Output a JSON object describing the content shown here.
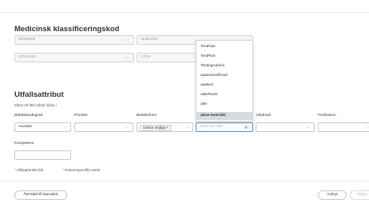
{
  "classification": {
    "title": "Medicinsk klassificeringskod",
    "row1_left_value": "SNOMED",
    "row1_right_value": "11381005",
    "row2_left_value": "ICD10-SE",
    "row2_right_value": "L70.9"
  },
  "attributes": {
    "title": "Utfallsattribut",
    "required_note": "Minst ett fält måste fyllas i",
    "columns": {
      "col1_label": "Brådskandegrad",
      "col1_value": "Avvakta",
      "col2_label": "Prioritet",
      "col2_value": "",
      "col3_label": "Besöksform",
      "col3_chip": "Online möjligt ×",
      "col4_label": "",
      "col4_placeholder": "akne-översikt",
      "col5_label": "Vårdnivå",
      "col5_value": "",
      "col6_label": "Profession",
      "col6_value": ""
    },
    "competence_label": "Kompetens",
    "competence_value": "",
    "footnote_required": "* Obligatoriskt fält",
    "footnote_partner": "* Partnerspecifikt värde"
  },
  "dropdown": {
    "items": [
      "TestPain",
      "TestPlan",
      "TestingAdvice",
      "aaanewselfcare",
      "aaatest",
      "aderbrack",
      "afte",
      "akne-översikt"
    ],
    "selected_index": 7
  },
  "footer": {
    "reset_label": "Återställ till standard",
    "cancel_label": "Avbryt",
    "save_label": "Spara"
  },
  "icons": {
    "chevron": "chevron-down-icon",
    "clear": "clear-icon"
  }
}
